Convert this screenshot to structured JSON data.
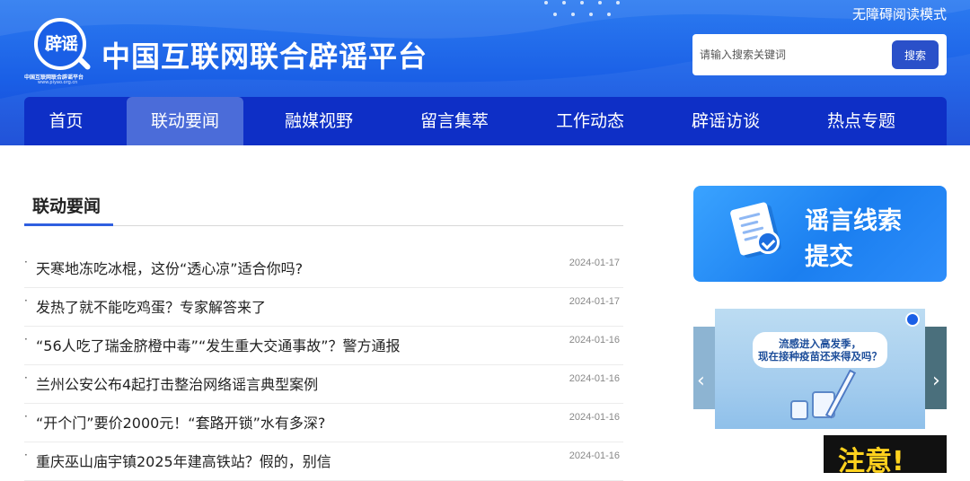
{
  "header": {
    "logo_text": "辟谣",
    "logo_caption": "中国互联网联合辟谣平台",
    "logo_url": "www.piyao.org.cn",
    "site_title": "中国互联网联合辟谣平台",
    "accessibility_label": "无障碍阅读模式",
    "search": {
      "placeholder": "请输入搜索关键词",
      "button_label": "搜索"
    }
  },
  "nav": {
    "items": [
      {
        "label": "首页"
      },
      {
        "label": "联动要闻",
        "active": true
      },
      {
        "label": "融媒视野"
      },
      {
        "label": "留言集萃"
      },
      {
        "label": "工作动态"
      },
      {
        "label": "辟谣访谈"
      },
      {
        "label": "热点专题"
      }
    ]
  },
  "main": {
    "section_title": "联动要闻",
    "bullet": "·",
    "news": [
      {
        "title": "天寒地冻吃冰棍，这份“透心凉”适合你吗?",
        "date": "2024-01-17"
      },
      {
        "title": "发热了就不能吃鸡蛋？专家解答来了",
        "date": "2024-01-17"
      },
      {
        "title": "“56人吃了瑞金脐橙中毒”“发生重大交通事故”？警方通报",
        "date": "2024-01-16"
      },
      {
        "title": "兰州公安公布4起打击整治网络谣言典型案例",
        "date": "2024-01-16"
      },
      {
        "title": "“开个门”要价2000元！“套路开锁”水有多深?",
        "date": "2024-01-16"
      },
      {
        "title": "重庆巫山庙宇镇2025年建高铁站？假的，别信",
        "date": "2024-01-16"
      }
    ]
  },
  "sidebar": {
    "banner_line1": "谣言线索",
    "banner_line2": "提交",
    "carousel_caption_line1": "流感进入高发季，",
    "carousel_caption_line2": "现在接种疫苗还来得及吗？",
    "carousel_prev": "‹",
    "carousel_next": "›",
    "notice_text": "注意!"
  },
  "colors": {
    "header_blue": "#1a5fe6",
    "nav_blue": "#0e2fc6",
    "nav_active": "#4b6cd9",
    "search_button": "#2a50c9",
    "section_accent": "#2f5fe0"
  }
}
